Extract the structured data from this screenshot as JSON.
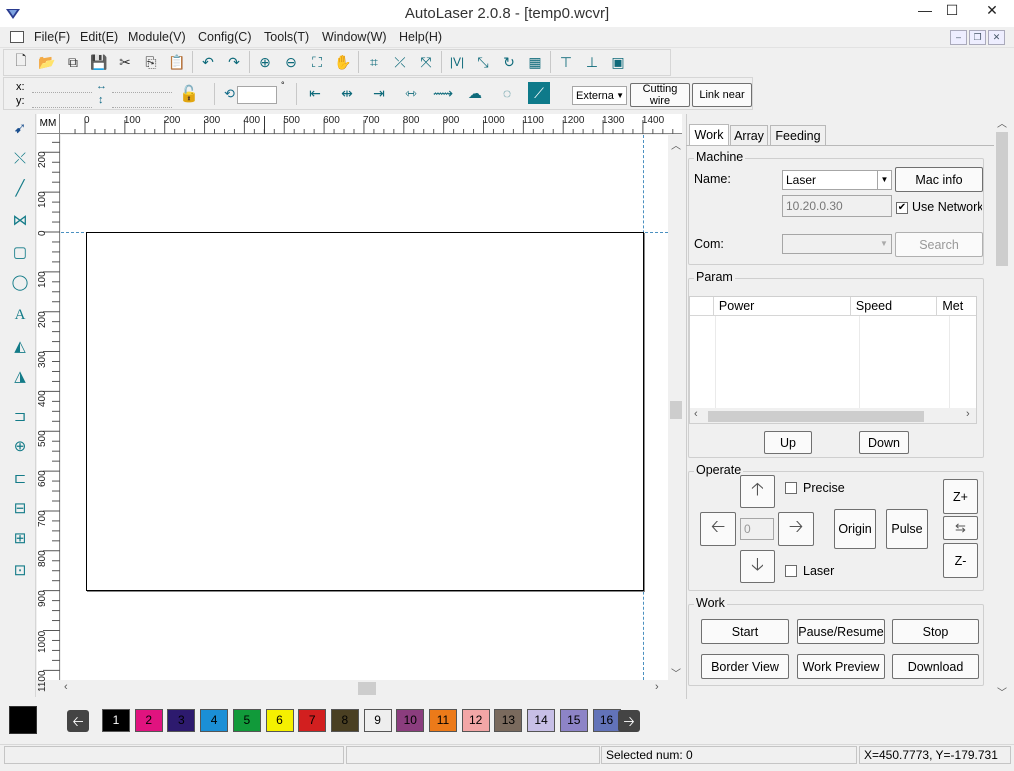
{
  "window": {
    "title": "AutoLaser 2.0.8 - [temp0.wcvr]",
    "minimize": "—",
    "maximize": "☐",
    "close": "✕"
  },
  "menu": [
    "File(F)",
    "Edit(E)",
    "Module(V)",
    "Config(C)",
    "Tools(T)",
    "Window(W)",
    "Help(H)"
  ],
  "coords": {
    "x_label": "x:",
    "y_label": "y:",
    "rotate_value": "",
    "degree": "°"
  },
  "toolbar2": {
    "combo_value": "Externa",
    "cutting_wire": "Cutting wire",
    "link_near": "Link near"
  },
  "ruler": {
    "unit": "MM",
    "top_ticks": [
      "0",
      "100",
      "200",
      "300",
      "400",
      "500",
      "600",
      "700",
      "800",
      "900",
      "1000",
      "1100",
      "1200",
      "1300",
      "1400"
    ],
    "left_ticks": [
      "200",
      "100",
      "0",
      "100",
      "200",
      "300",
      "400",
      "500",
      "600",
      "700",
      "800",
      "900",
      "1000",
      "1100"
    ]
  },
  "panel": {
    "tabs": [
      "Work",
      "Array",
      "Feeding"
    ],
    "machine": {
      "group": "Machine",
      "name_label": "Name:",
      "name_value": "Laser",
      "mac_info": "Mac info",
      "ip": "10.20.0.30",
      "use_network": "Use Network",
      "com_label": "Com:",
      "search": "Search"
    },
    "param": {
      "group": "Param",
      "columns": [
        "Power",
        "Speed",
        "Met"
      ],
      "up": "Up",
      "down": "Down"
    },
    "operate": {
      "group": "Operate",
      "precise": "Precise",
      "laser": "Laser",
      "step": "0",
      "origin": "Origin",
      "pulse": "Pulse",
      "z_plus": "Z+",
      "z_minus": "Z-"
    },
    "work": {
      "group": "Work",
      "start": "Start",
      "pause": "Pause/Resume",
      "stop": "Stop",
      "border_view": "Border View",
      "work_preview": "Work Preview",
      "download": "Download"
    }
  },
  "layers": [
    {
      "n": "1",
      "color": "#000000",
      "fg": "#ffffff"
    },
    {
      "n": "2",
      "color": "#e0137f",
      "fg": "#000000"
    },
    {
      "n": "3",
      "color": "#2d1a6e",
      "fg": "#000000"
    },
    {
      "n": "4",
      "color": "#1b8fd6",
      "fg": "#000000"
    },
    {
      "n": "5",
      "color": "#119a3a",
      "fg": "#000000"
    },
    {
      "n": "6",
      "color": "#f5f000",
      "fg": "#000000"
    },
    {
      "n": "7",
      "color": "#d21f1f",
      "fg": "#000000"
    },
    {
      "n": "8",
      "color": "#4a3f22",
      "fg": "#000000"
    },
    {
      "n": "9",
      "color": "#eeeeee",
      "fg": "#000000"
    },
    {
      "n": "10",
      "color": "#8b3d7e",
      "fg": "#000000"
    },
    {
      "n": "11",
      "color": "#ec7a19",
      "fg": "#000000"
    },
    {
      "n": "12",
      "color": "#f2a6a6",
      "fg": "#000000"
    },
    {
      "n": "13",
      "color": "#7a6a5d",
      "fg": "#000000"
    },
    {
      "n": "14",
      "color": "#c7bfe6",
      "fg": "#000000"
    },
    {
      "n": "15",
      "color": "#8d84c7",
      "fg": "#000000"
    },
    {
      "n": "16",
      "color": "#6273b9",
      "fg": "#000000"
    }
  ],
  "status": {
    "selected": "Selected num: 0",
    "xy": "X=450.7773, Y=-179.731"
  }
}
